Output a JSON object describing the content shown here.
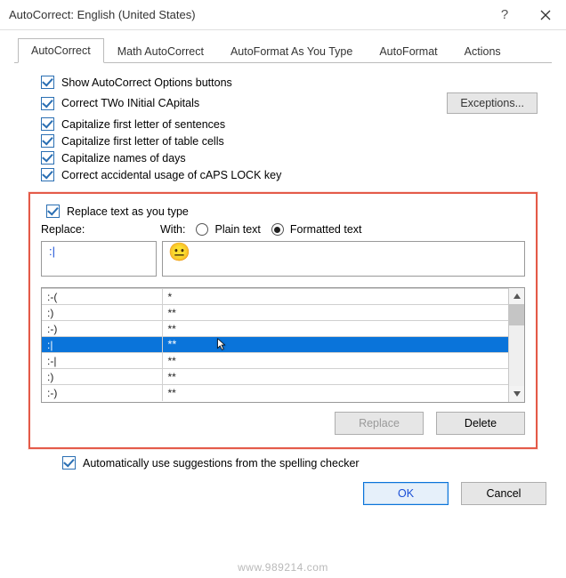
{
  "title": "AutoCorrect: English (United States)",
  "tabs": [
    "AutoCorrect",
    "Math AutoCorrect",
    "AutoFormat As You Type",
    "AutoFormat",
    "Actions"
  ],
  "active_tab": 0,
  "top_checks": [
    "Show AutoCorrect Options buttons",
    "Correct TWo INitial CApitals",
    "Capitalize first letter of sentences",
    "Capitalize first letter of table cells",
    "Capitalize names of days",
    "Correct accidental usage of cAPS LOCK key"
  ],
  "exceptions_btn": "Exceptions...",
  "replace_check": "Replace text as you type",
  "replace_label": "Replace:",
  "with_label": "With:",
  "radio_plain": "Plain text",
  "radio_formatted": "Formatted text",
  "radio_selected": "formatted",
  "replace_value": ":|",
  "with_value": "😐",
  "list_rows": [
    {
      "a": ":-(",
      "b": "*"
    },
    {
      "a": ":)",
      "b": "**"
    },
    {
      "a": ":-)",
      "b": "**"
    },
    {
      "a": ":|",
      "b": "**",
      "selected": true
    },
    {
      "a": ":-|",
      "b": "**"
    },
    {
      "a": ":)",
      "b": "**"
    },
    {
      "a": ":-)",
      "b": "**"
    }
  ],
  "replace_btn": "Replace",
  "delete_btn": "Delete",
  "suggest_check": "Automatically use suggestions from the spelling checker",
  "ok_btn": "OK",
  "cancel_btn": "Cancel",
  "watermark": "www.989214.com"
}
